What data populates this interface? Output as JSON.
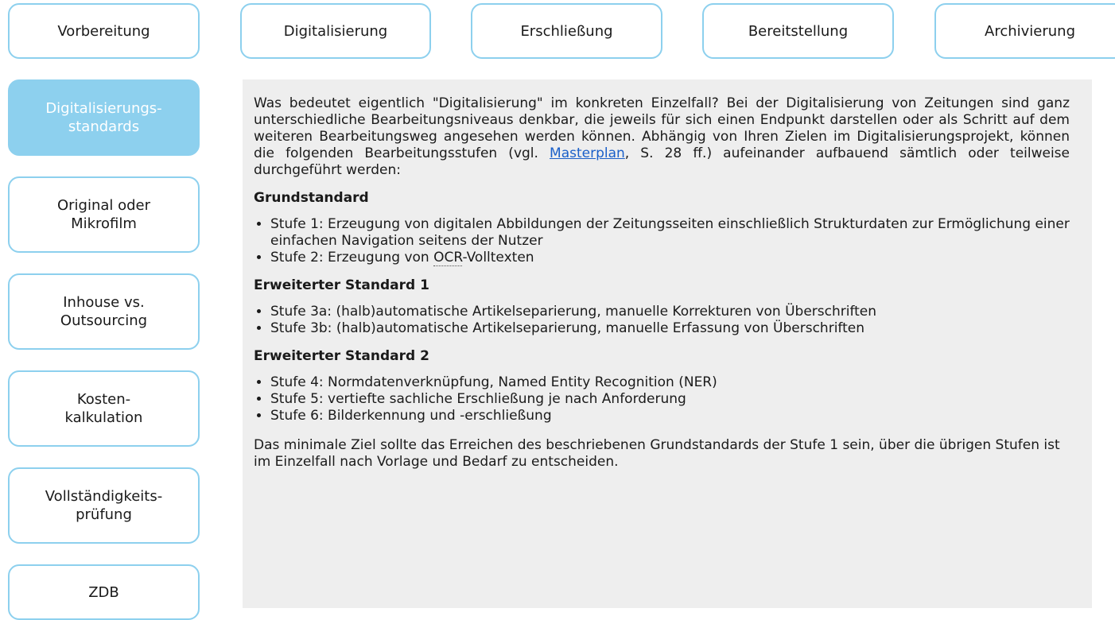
{
  "top_tabs": [
    {
      "label": "Vorbereitung"
    },
    {
      "label": "Digitalisierung"
    },
    {
      "label": "Erschließung"
    },
    {
      "label": "Bereitstellung"
    },
    {
      "label": "Archivierung"
    }
  ],
  "sidebar": {
    "items": [
      {
        "label": "Digitalisierungs-\nstandards",
        "active": true
      },
      {
        "label": "Original oder\nMikrofilm"
      },
      {
        "label": "Inhouse vs.\nOutsourcing"
      },
      {
        "label": "Kosten-\nkalkulation"
      },
      {
        "label": "Vollständigkeits-\nprüfung"
      },
      {
        "label": "ZDB"
      }
    ]
  },
  "content": {
    "intro_before_link": "Was bedeutet eigentlich \"Digitalisierung\" im konkreten Einzelfall? Bei der Digitalisierung von Zeitungen sind ganz unterschiedliche Bearbeitungsniveaus denkbar, die jeweils für sich einen Endpunkt darstellen oder als Schritt auf dem weiteren Bearbeitungsweg angesehen werden können. Abhängig von Ihren Zielen im Digitalisierungsprojekt, können die folgenden Bearbeitungsstufen (vgl. ",
    "intro_link": "Masterplan",
    "intro_after_link": ", S. 28 ff.) aufeinander aufbauend sämtlich oder teilweise durchgeführt werden:",
    "grund": {
      "heading": "Grundstandard",
      "item1": "Stufe 1: Erzeugung von digitalen Abbildungen der Zeitungsseiten einschließlich Strukturdaten zur Ermöglichung einer einfachen Navigation seitens der Nutzer",
      "item2_prefix": "Stufe 2: Erzeugung von ",
      "item2_abbr": "OCR",
      "item2_suffix": "-Volltexten"
    },
    "erw1": {
      "heading": "Erweiterter Standard 1",
      "items": [
        "Stufe 3a: (halb)automatische Artikelseparierung, manuelle Korrekturen von Überschriften",
        "Stufe 3b: (halb)automatische Artikelseparierung, manuelle Erfassung von Überschriften"
      ]
    },
    "erw2": {
      "heading": "Erweiterter Standard 2",
      "items": [
        "Stufe 4: Normdatenverknüpfung, Named Entity Recognition (NER)",
        "Stufe 5: vertiefte sachliche Erschließung je nach Anforderung",
        "Stufe 6: Bilderkennung und -erschließung"
      ]
    },
    "outro": "Das minimale Ziel sollte das Erreichen des beschriebenen Grundstandards der Stufe 1 sein, über die übrigen Stufen ist im Einzelfall nach Vorlage und Bedarf zu entscheiden."
  },
  "colors": {
    "accent": "#8dd0ee",
    "content_bg": "#eeeeee",
    "link": "#1a5fc9"
  }
}
